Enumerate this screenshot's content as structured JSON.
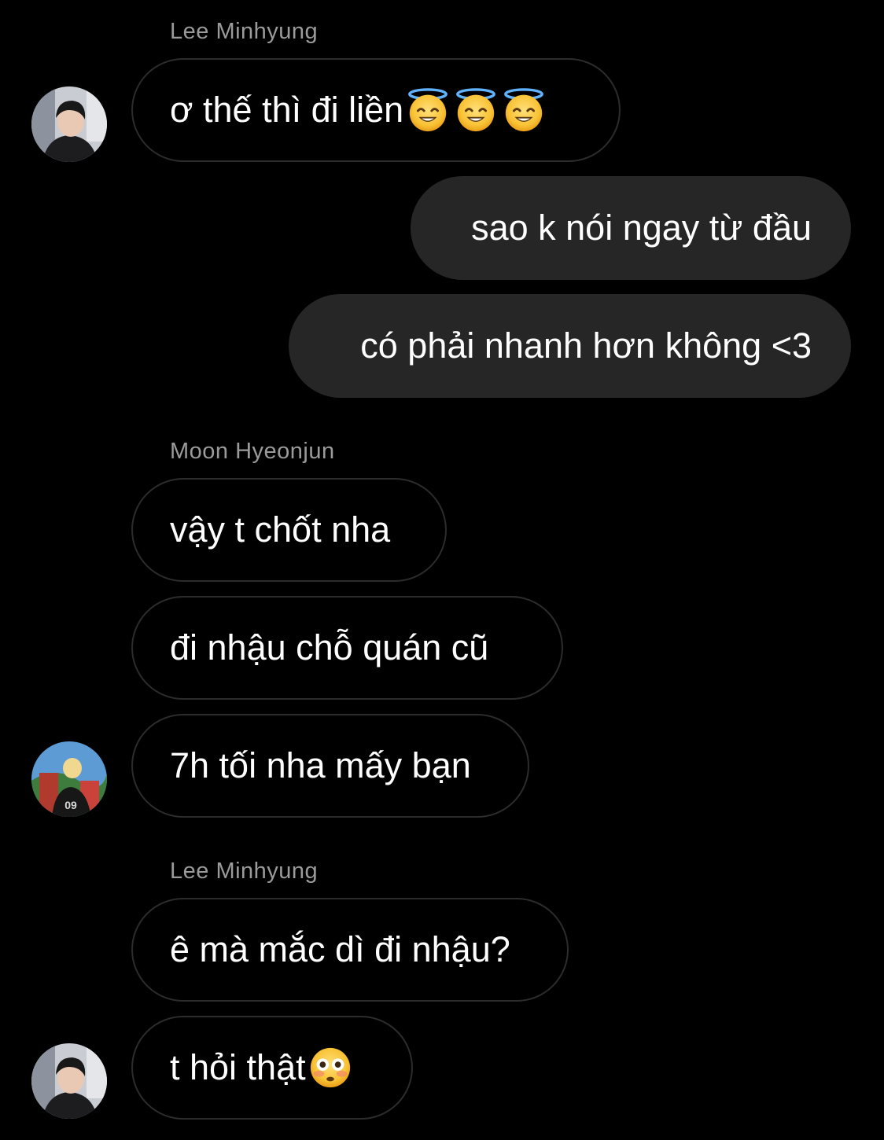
{
  "chat": {
    "groups": [
      {
        "sender": "Lee Minhyung"
      },
      {
        "sender": "Moon Hyeonjun"
      },
      {
        "sender": "Lee Minhyung"
      }
    ],
    "messages": [
      {
        "text": "ơ thế thì đi liền",
        "emoji": [
          "smiling-face-with-halo",
          "smiling-face-with-halo",
          "smiling-face-with-halo"
        ]
      },
      {
        "text": "sao k nói ngay từ đầu"
      },
      {
        "text": "có phải nhanh hơn không <3"
      },
      {
        "text": "vậy t chốt nha"
      },
      {
        "text": "đi nhậu chỗ quán cũ"
      },
      {
        "text": "7h tối nha mấy bạn"
      },
      {
        "text": "ê mà mắc dì đi nhậu?"
      },
      {
        "text": "t hỏi thật",
        "emoji": [
          "flushed-face"
        ]
      }
    ],
    "avatars": {
      "lee_minhyung": "avatar-photo",
      "moon_hyeonjun": "avatar-photo"
    }
  },
  "colors": {
    "background": "#000000",
    "outgoing_bubble": "#262626",
    "incoming_border": "#2c2c2c",
    "sender_name": "#9b9b9b"
  }
}
